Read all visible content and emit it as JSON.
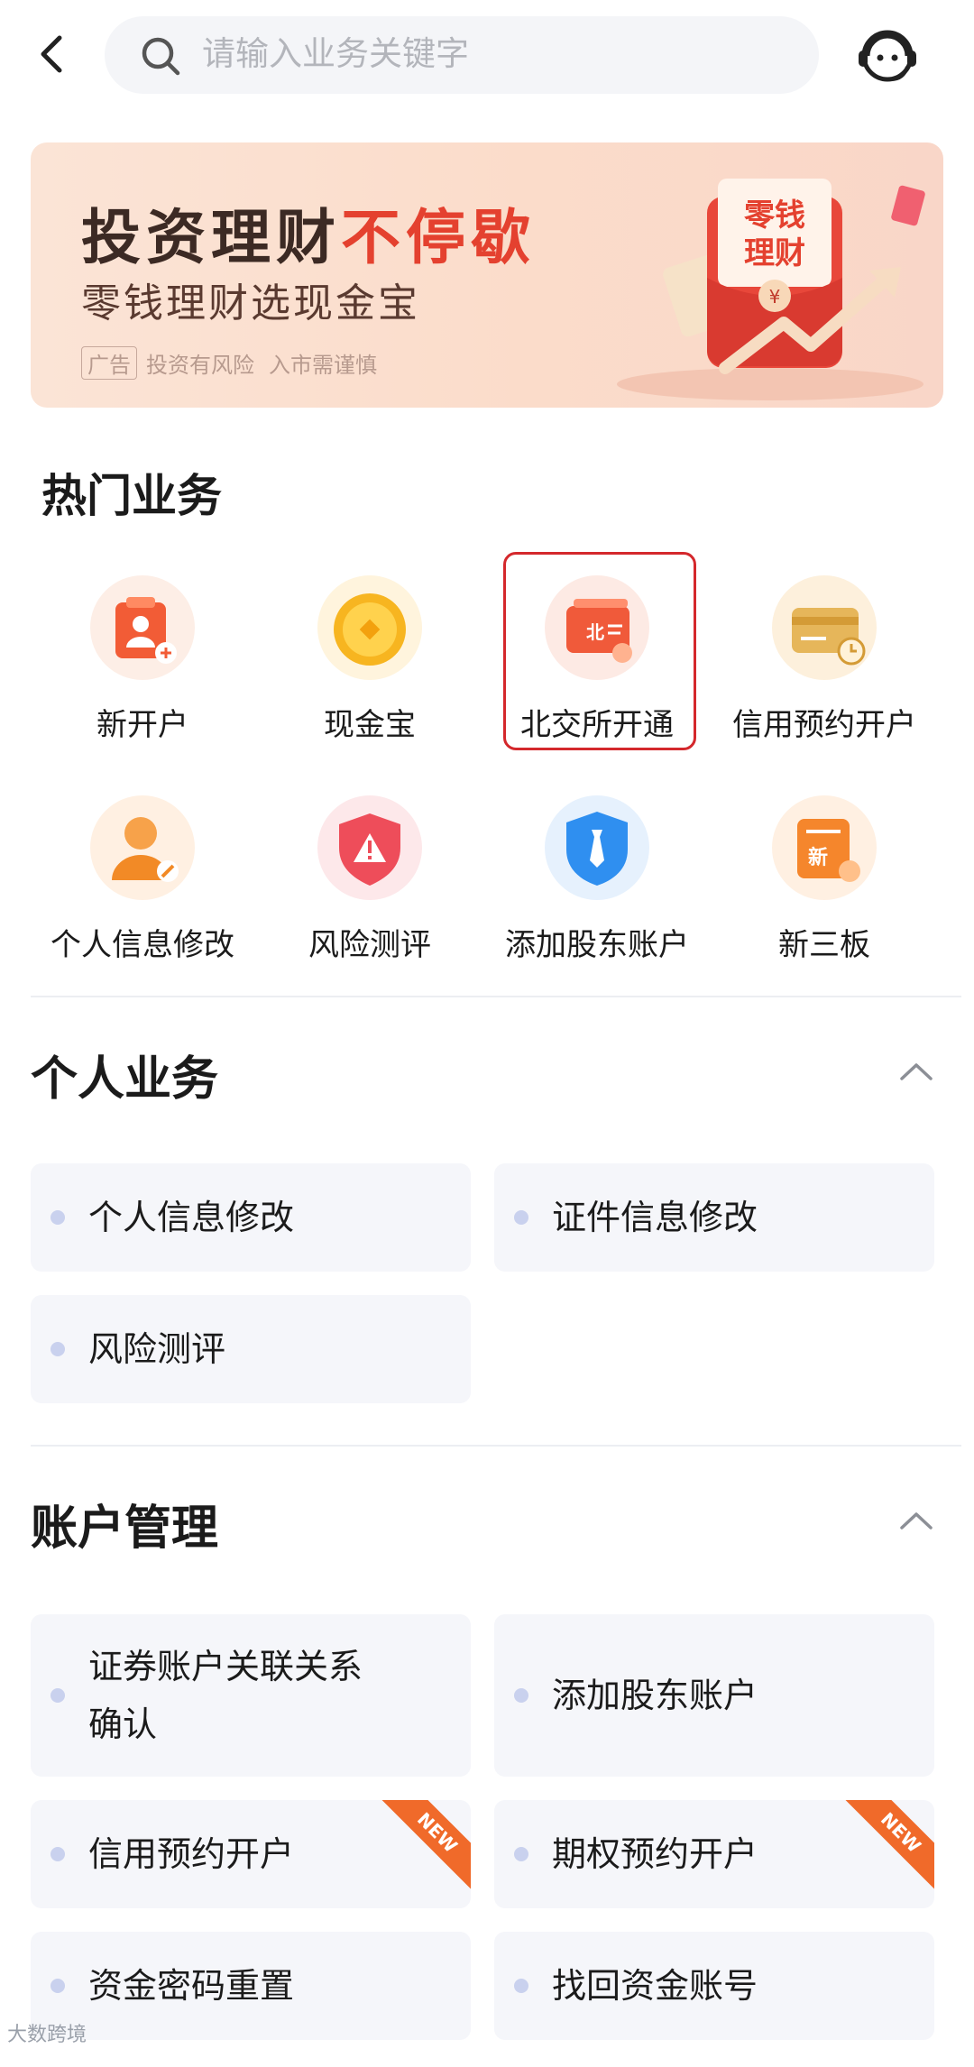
{
  "search": {
    "placeholder": "请输入业务关键字"
  },
  "icons": {
    "back": "back-arrow-icon",
    "search": "search-icon",
    "customer_service": "customer-service-icon"
  },
  "banner": {
    "title_main": "投资理财",
    "title_highlight": "不停歇",
    "subtitle": "零钱理财选现金宝",
    "ad_tag": "广告",
    "risk_text": "投资有风险",
    "caution_text": "入市需谨慎",
    "envelope_text": "零钱理财"
  },
  "hot": {
    "title": "热门业务",
    "items": [
      {
        "label": "新开户",
        "icon": "new-account-icon"
      },
      {
        "label": "现金宝",
        "icon": "gold-coin-icon"
      },
      {
        "label": "北交所开通",
        "icon": "bse-card-icon",
        "selected": true
      },
      {
        "label": "信用预约开户",
        "icon": "credit-card-clock-icon"
      },
      {
        "label": "个人信息修改",
        "icon": "person-edit-icon"
      },
      {
        "label": "风险测评",
        "icon": "warning-shield-icon"
      },
      {
        "label": "添加股东账户",
        "icon": "tie-shield-icon"
      },
      {
        "label": "新三板",
        "icon": "neeq-doc-icon"
      }
    ]
  },
  "personal": {
    "title": "个人业务",
    "items": [
      "个人信息修改",
      "证件信息修改",
      "风险测评"
    ]
  },
  "account": {
    "title": "账户管理",
    "items": [
      "证券账户关联关系",
      "确认",
      "添加股东账户",
      "信用预约开户",
      "期权预约开户",
      "资金密码重置",
      "找回资金账号"
    ],
    "new_badge": "NEW"
  },
  "watermark": "大数跨境",
  "colors": {
    "accent": "#e4412f",
    "highlight_border": "#d4282c",
    "card_bg": "#f5f6fa",
    "badge": "#f06a2a"
  }
}
